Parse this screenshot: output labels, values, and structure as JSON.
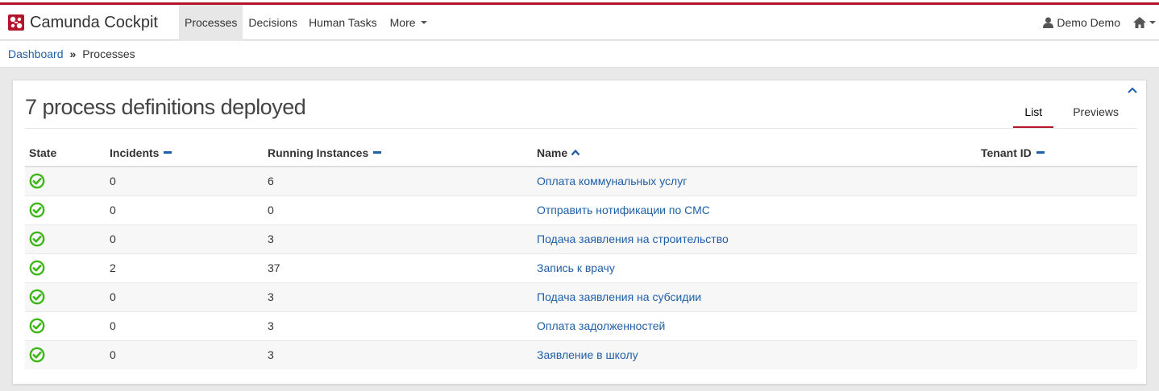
{
  "app": {
    "title": "Camunda Cockpit"
  },
  "nav": {
    "items": [
      {
        "label": "Processes",
        "active": true
      },
      {
        "label": "Decisions",
        "active": false
      },
      {
        "label": "Human Tasks",
        "active": false
      },
      {
        "label": "More",
        "active": false
      }
    ],
    "user_label": "Demo Demo",
    "user_icon": "user-icon",
    "home_icon": "home-icon"
  },
  "breadcrumb": {
    "home": "Dashboard",
    "separator": "»",
    "current": "Processes"
  },
  "panel": {
    "title": "7 process definitions deployed",
    "tabs": [
      {
        "label": "List",
        "active": true
      },
      {
        "label": "Previews",
        "active": false
      }
    ]
  },
  "table": {
    "columns": {
      "state": "State",
      "incidents": "Incidents",
      "running": "Running Instances",
      "name": "Name",
      "tenant": "Tenant ID"
    },
    "rows": [
      {
        "state": "ok",
        "incidents": "0",
        "running": "6",
        "name": "Оплата коммунальных услуг",
        "tenant": ""
      },
      {
        "state": "ok",
        "incidents": "0",
        "running": "0",
        "name": "Отправить нотификации по СМС",
        "tenant": ""
      },
      {
        "state": "ok",
        "incidents": "0",
        "running": "3",
        "name": "Подача заявления на строительство",
        "tenant": ""
      },
      {
        "state": "ok",
        "incidents": "2",
        "running": "37",
        "name": "Запись к врачу",
        "tenant": ""
      },
      {
        "state": "ok",
        "incidents": "0",
        "running": "3",
        "name": "Подача заявления на субсидии",
        "tenant": ""
      },
      {
        "state": "ok",
        "incidents": "0",
        "running": "3",
        "name": "Оплата задолженностей",
        "tenant": ""
      },
      {
        "state": "ok",
        "incidents": "0",
        "running": "3",
        "name": "Заявление в школу",
        "tenant": ""
      }
    ]
  },
  "colors": {
    "accent_red": "#b5152b",
    "link_blue": "#1f5fa8",
    "ok_green": "#3fb618"
  }
}
